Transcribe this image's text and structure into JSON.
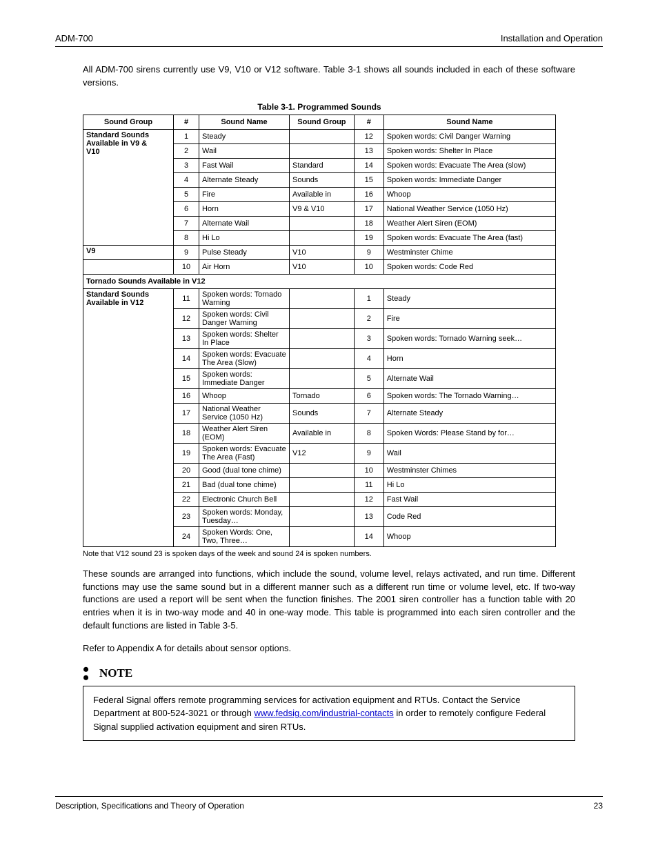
{
  "header": {
    "left": "ADM-700",
    "right": "Installation and Operation"
  },
  "intro": "All ADM-700 sirens currently use V9, V10 or V12 software. Table 3-1 shows all sounds included in each of these software versions.",
  "table": {
    "caption": "Table 3-1. Programmed Sounds",
    "cols": [
      "Sound Group",
      "#",
      "Sound Name",
      "Sound Group",
      "#",
      "Sound Name"
    ],
    "group1": {
      "label": "Standard Sounds\nAvailable in V9 &\nV10",
      "rows": [
        [
          "1",
          "Steady",
          "",
          "12",
          "Spoken words: Civil Danger Warning"
        ],
        [
          "2",
          "Wail",
          "",
          "13",
          "Spoken words: Shelter In Place"
        ],
        [
          "3",
          "Fast Wail",
          "Standard",
          "14",
          "Spoken words: Evacuate The Area (slow)"
        ],
        [
          "4",
          "Alternate Steady",
          "Sounds",
          "15",
          "Spoken words: Immediate Danger"
        ],
        [
          "5",
          "Fire",
          "Available in",
          "16",
          "Whoop"
        ],
        [
          "6",
          "Horn",
          "V9 & V10",
          "17",
          "National Weather Service (1050 Hz)"
        ],
        [
          "7",
          "Alternate Wail",
          "",
          "18",
          "Weather Alert Siren (EOM)"
        ],
        [
          "8",
          "Hi Lo",
          "",
          "19",
          "Spoken words: Evacuate The Area (fast)"
        ]
      ]
    },
    "group2": {
      "left": [
        "V9",
        "9",
        "Pulse Steady"
      ],
      "right": [
        "V10",
        "9",
        "Westminster Chime"
      ]
    },
    "group3": {
      "left": [
        "",
        "10",
        "Air Horn"
      ],
      "right": [
        "V10",
        "10",
        "Spoken words: Code Red"
      ]
    },
    "span": "Tornado Sounds Available in V12",
    "group4": {
      "label": "Standard Sounds\nAvailable in V12",
      "rows": [
        [
          "11",
          "Spoken words: Tornado Warning",
          "",
          "1",
          "Steady"
        ],
        [
          "12",
          "Spoken words: Civil Danger Warning",
          "",
          "2",
          "Fire"
        ],
        [
          "13",
          "Spoken words: Shelter In Place",
          "",
          "3",
          "Spoken words: Tornado Warning seek…"
        ],
        [
          "14",
          "Spoken words: Evacuate The Area (Slow)",
          "",
          "4",
          "Horn"
        ],
        [
          "15",
          "Spoken words: Immediate Danger",
          "",
          "5",
          "Alternate Wail"
        ],
        [
          "16",
          "Whoop",
          "Tornado",
          "6",
          "Spoken words: The Tornado Warning…"
        ],
        [
          "17",
          "National Weather Service (1050 Hz)",
          "Sounds",
          "7",
          "Alternate Steady"
        ],
        [
          "18",
          "Weather Alert Siren (EOM)",
          "Available in",
          "8",
          "Spoken Words: Please Stand by for…"
        ],
        [
          "19",
          "Spoken words: Evacuate The Area (Fast)",
          "V12",
          "9",
          "Wail"
        ],
        [
          "20",
          "Good (dual tone chime)",
          "",
          "10",
          "Westminster Chimes"
        ],
        [
          "21",
          "Bad (dual tone chime)",
          "",
          "11",
          "Hi Lo"
        ],
        [
          "22",
          "Electronic Church Bell",
          "",
          "12",
          "Fast Wail"
        ],
        [
          "23",
          "Spoken words: Monday, Tuesday…",
          "",
          "13",
          "Code Red"
        ],
        [
          "24",
          "Spoken Words: One, Two, Three…",
          "",
          "14",
          "Whoop"
        ]
      ]
    }
  },
  "daynote": "Note that V12 sound 23 is spoken days of the week and sound 24 is spoken numbers.",
  "paras": [
    "These sounds are arranged into functions, which include the sound, volume level, relays activated, and run time. Different functions may use the same sound but in a different manner such as a different run time or volume level, etc. If two-way functions are used a report will be sent when the function finishes. The 2001 siren controller has a function table with 20 entries when it is in two-way mode and 40 in one-way mode. This table is programmed into each siren controller and the default functions are listed in Table 3-5.",
    "Refer to Appendix A for details about sensor options."
  ],
  "note": {
    "title": "NOTE",
    "text_before": "Federal Signal offers remote programming services for activation equipment and RTUs. Contact the Service Department at 800-524-3021 or through ",
    "link_text": "www.fedsig.com/industrial-contacts",
    "link_href": "#",
    "text_after": " in order to remotely configure Federal Signal supplied activation equipment and siren RTUs."
  },
  "footer": {
    "left": "Description, Specifications and Theory of Operation",
    "right": "23"
  }
}
